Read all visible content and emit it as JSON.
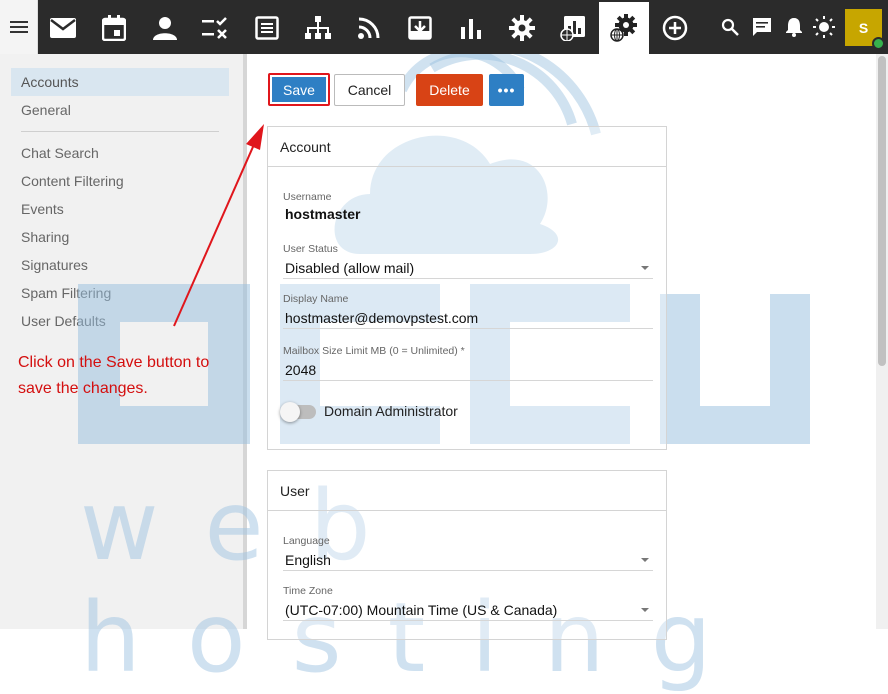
{
  "topbar": {
    "apps": [
      {
        "name": "email-icon",
        "active": false
      },
      {
        "name": "calendar-icon",
        "active": false
      },
      {
        "name": "contacts-icon",
        "active": false
      },
      {
        "name": "tasks-icon",
        "active": false
      },
      {
        "name": "notes-icon",
        "active": false
      },
      {
        "name": "sitemap-icon",
        "active": false
      },
      {
        "name": "rss-icon",
        "active": false
      },
      {
        "name": "archive-download-icon",
        "active": false
      },
      {
        "name": "bar-chart-icon",
        "active": false
      },
      {
        "name": "gear-icon",
        "active": false
      },
      {
        "name": "domain-reports-icon",
        "active": false
      },
      {
        "name": "domain-settings-icon",
        "active": true
      },
      {
        "name": "add-circle-icon",
        "active": false
      }
    ],
    "right": [
      "search-icon",
      "chat-icon",
      "bell-icon",
      "brightness-icon"
    ],
    "avatar_initial": "S"
  },
  "sidebar": {
    "items": [
      {
        "label": "Accounts",
        "active": true
      },
      {
        "label": "General",
        "active": false
      },
      {
        "label": "Chat Search",
        "active": false
      },
      {
        "label": "Content Filtering",
        "active": false
      },
      {
        "label": "Events",
        "active": false
      },
      {
        "label": "Sharing",
        "active": false
      },
      {
        "label": "Signatures",
        "active": false
      },
      {
        "label": "Spam Filtering",
        "active": false
      },
      {
        "label": "User Defaults",
        "active": false
      }
    ],
    "annotation": "Click on the Save button to save the changes."
  },
  "toolbar": {
    "save_label": "Save",
    "cancel_label": "Cancel",
    "delete_label": "Delete",
    "more_label": "•••"
  },
  "account": {
    "title": "Account",
    "username_label": "Username",
    "username_value": "hostmaster",
    "status_label": "User Status",
    "status_value": "Disabled (allow mail)",
    "display_label": "Display Name",
    "display_value": "hostmaster@demovpstest.com",
    "mailbox_label": "Mailbox Size Limit MB (0 = Unlimited) *",
    "mailbox_value": "2048",
    "domain_admin_label": "Domain Administrator",
    "domain_admin_on": false
  },
  "user": {
    "title": "User",
    "language_label": "Language",
    "language_value": "English",
    "timezone_label": "Time Zone",
    "timezone_value": "(UTC-07:00) Mountain Time (US & Canada)"
  },
  "watermark": {
    "text": "web hosting"
  },
  "colors": {
    "primary": "#2e7fc4",
    "danger": "#d84315",
    "highlight": "#e0161c",
    "annotation": "#d40f0f",
    "topbar": "#2b2b2b"
  }
}
